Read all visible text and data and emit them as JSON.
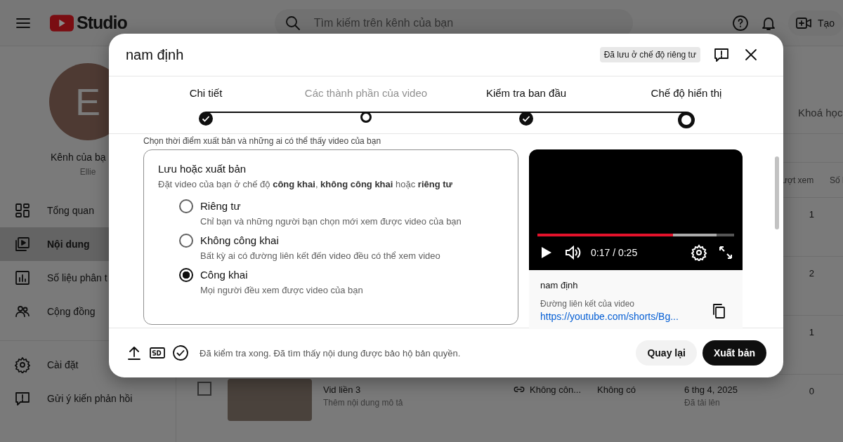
{
  "header": {
    "logo_text": "Studio",
    "search": {
      "placeholder": "Tìm kiếm trên kênh của bạn"
    },
    "create_label": "Tạo"
  },
  "sidebar": {
    "avatar_letter": "E",
    "channel_name": "Kênh của bạ",
    "handle": "Ellie",
    "items": [
      {
        "label": "Tổng quan",
        "kind": "dashboard",
        "selected": false
      },
      {
        "label": "Nội dung",
        "kind": "content",
        "selected": true
      },
      {
        "label": "Số liệu phân t",
        "kind": "analytics",
        "selected": false
      },
      {
        "label": "Cộng đồng",
        "kind": "community",
        "selected": false
      }
    ],
    "footer_items": [
      {
        "label": "Cài đặt",
        "kind": "settings"
      },
      {
        "label": "Gửi ý kiến phản hồi",
        "kind": "feedback"
      }
    ]
  },
  "content": {
    "tab_label": "Khoá học",
    "columns": [
      "ượt xem",
      "Số l"
    ],
    "view_counts": [
      "1",
      "2",
      "1"
    ],
    "last_row": {
      "checked": false,
      "title": "Vid liền 3",
      "description": "Thêm nội dung mô tả",
      "visibility": "Không côn...",
      "restrictions": "Không có",
      "date": "6 thg 4, 2025",
      "date_note": "Đã tải lên",
      "views": "0"
    }
  },
  "dialog": {
    "title": "nam định",
    "save_status": "Đã lưu ở chế độ riêng tư",
    "steps": [
      {
        "label": "Chi tiết",
        "completed": true,
        "selected": false
      },
      {
        "label": "Các thành phần của video",
        "completed": false,
        "selected": false
      },
      {
        "label": "Kiểm tra ban đầu",
        "completed": true,
        "selected": false
      },
      {
        "label": "Chế độ hiển thị",
        "completed": false,
        "selected": true
      }
    ],
    "intro": "Chọn thời điểm xuất bản và những ai có thể thấy video của bạn",
    "visibility_card": {
      "title": "Lưu hoặc xuất bản",
      "subtitle": "Đặt video của bạn ở chế độ **công khai**, **không công khai** hoặc **riêng tư**",
      "options": [
        {
          "label": "Riêng tư",
          "description": "Chỉ bạn và những người bạn chọn mới xem được video của bạn",
          "selected": false
        },
        {
          "label": "Không công khai",
          "description": "Bất kỳ ai có đường liên kết đến video đều có thể xem video",
          "selected": false
        },
        {
          "label": "Công khai",
          "description": "Mọi người đều xem được video của bạn",
          "selected": true
        }
      ]
    },
    "preview": {
      "progress": {
        "level": 0.69
      },
      "buffer": {
        "level": 0.91
      },
      "time": "0:17 / 0:25",
      "video_title": "nam định",
      "link_label": "Đường liên kết của video",
      "link": "https://youtube.com/shorts/Bg..."
    },
    "footer": {
      "status_text": "Đã kiểm tra xong. Đã tìm thấy nội dung được bảo hộ bản quyền.",
      "buttons": [
        {
          "label": "Quay lại",
          "kind": "secondary"
        },
        {
          "label": "Xuất bản",
          "kind": "primary"
        }
      ]
    }
  }
}
